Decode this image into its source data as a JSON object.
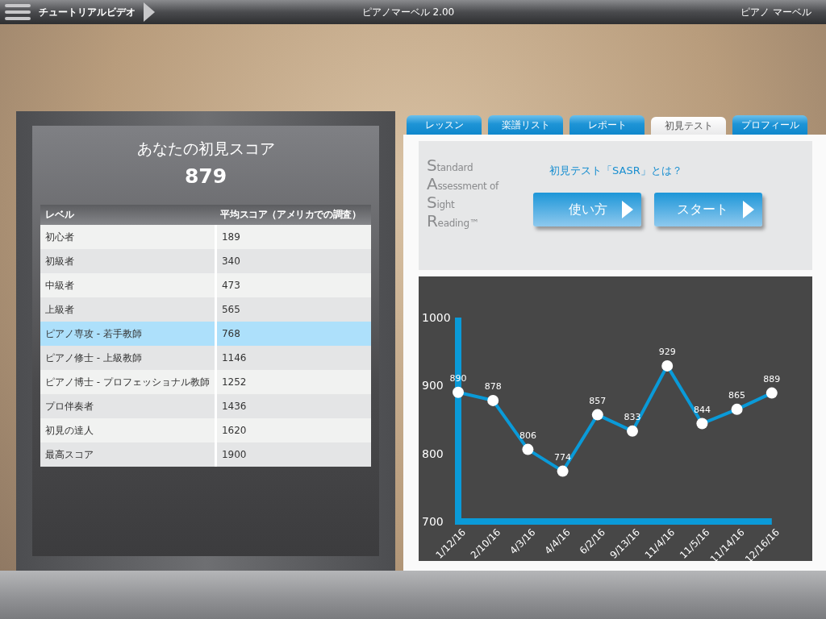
{
  "top_bar": {
    "menu_label": "チュートリアルビデオ",
    "title": "ピアノマーベル 2.00",
    "user": "ピアノ マーベル"
  },
  "score_panel": {
    "title": "あなたの初見スコア",
    "score": "879",
    "table": {
      "columns": [
        "レベル",
        "平均スコア（アメリカでの調査）"
      ],
      "rows": [
        {
          "level": "初心者",
          "score": "189",
          "selected": false
        },
        {
          "level": "初級者",
          "score": "340",
          "selected": false
        },
        {
          "level": "中級者",
          "score": "473",
          "selected": false
        },
        {
          "level": "上級者",
          "score": "565",
          "selected": false
        },
        {
          "level": "ピアノ専攻 - 若手教師",
          "score": "768",
          "selected": true
        },
        {
          "level": "ピアノ修士 - 上級教師",
          "score": "1146",
          "selected": false
        },
        {
          "level": "ピアノ博士 - プロフェッショナル教師",
          "score": "1252",
          "selected": false
        },
        {
          "level": "プロ伴奏者",
          "score": "1436",
          "selected": false
        },
        {
          "level": "初見の達人",
          "score": "1620",
          "selected": false
        },
        {
          "level": "最高スコア",
          "score": "1900",
          "selected": false
        }
      ]
    }
  },
  "tabs": [
    {
      "label": "レッスン",
      "selected": false
    },
    {
      "label": "楽譜リスト",
      "selected": false
    },
    {
      "label": "レポート",
      "selected": false
    },
    {
      "label": "初見テスト",
      "selected": true
    },
    {
      "label": "プロフィール",
      "selected": false
    }
  ],
  "test_panel": {
    "logo_lines": [
      "Standard",
      "Assessment of",
      "Sight",
      "Reading™"
    ],
    "question_link": "初見テスト「SASR」とは？",
    "buttons": [
      "使い方",
      "スタート"
    ],
    "chart_data": {
      "type": "line",
      "categories": [
        "1/12/16",
        "2/10/16",
        "4/3/16",
        "4/4/16",
        "6/2/16",
        "9/13/16",
        "11/4/16",
        "11/5/16",
        "11/14/16",
        "12/16/16"
      ],
      "series": [
        {
          "color": "#0a9ad8",
          "marker": "circle",
          "values": [
            890,
            878,
            806,
            774,
            857,
            833,
            929,
            844,
            865,
            889
          ]
        }
      ],
      "ylim": [
        700,
        1000
      ],
      "yticks": [
        700,
        800,
        900,
        1000
      ],
      "data_labels": true
    }
  }
}
